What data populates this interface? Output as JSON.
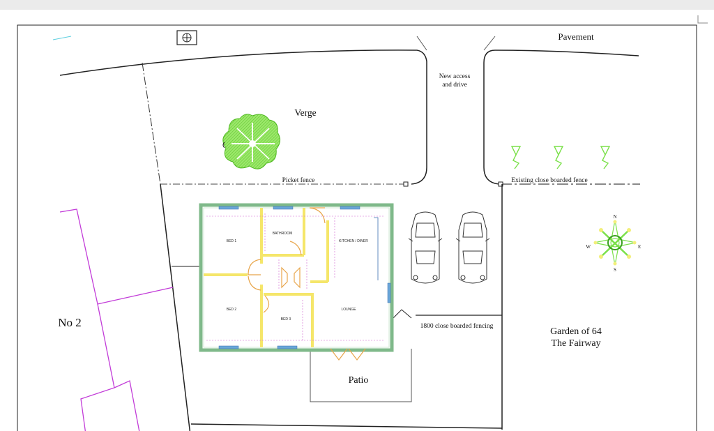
{
  "labels": {
    "pavement": "Pavement",
    "new_access": "New access",
    "and_drive": "and drive",
    "verge": "Verge",
    "picket_fence": "Picket fence",
    "existing_fence": "Existing close boarded fence",
    "no2": "No 2",
    "fencing_1800": "1800 close boarded fencing",
    "garden_line1": "Garden of 64",
    "garden_line2": "The Fairway",
    "patio": "Patio"
  },
  "rooms": {
    "bed1": "BED 1",
    "bathroom": "BATHROOM",
    "kitchen": "KITCHEN / DINER",
    "bed2": "BED 2",
    "bed3": "BED 3",
    "lounge": "LOUNGE"
  },
  "compass": {
    "n": "N",
    "s": "S",
    "e": "E",
    "w": "W"
  },
  "colors": {
    "wall_green": "#7fb98a",
    "partition_yellow": "#f5e66a",
    "tree_green": "#7be04a",
    "neighbour_magenta": "#c23cd8",
    "door_orange": "#e8a54a",
    "window_blue": "#6aa6d8",
    "dimension_magenta": "#d060d0"
  }
}
